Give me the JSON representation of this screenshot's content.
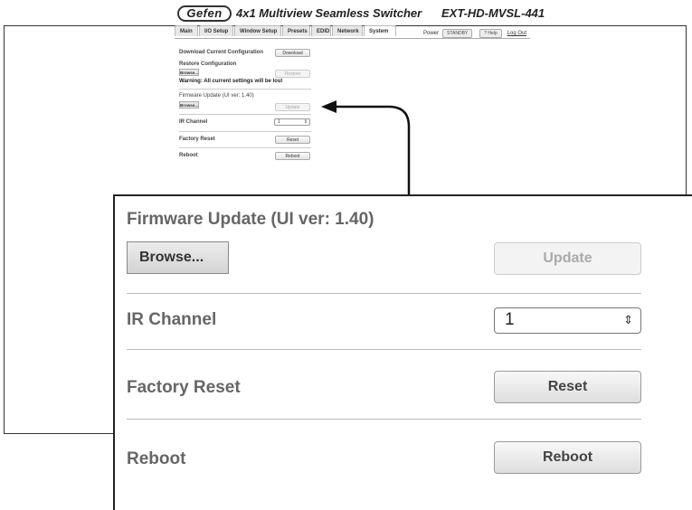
{
  "header": {
    "logo": "Gefen",
    "title": "4x1 Multiview Seamless Switcher",
    "model": "EXT-HD-MVSL-441"
  },
  "tabs": [
    {
      "label": "Main"
    },
    {
      "label": "I/O Setup"
    },
    {
      "label": "Window Setup"
    },
    {
      "label": "Presets"
    },
    {
      "label": "EDID"
    },
    {
      "label": "Network"
    },
    {
      "label": "System",
      "active": true
    }
  ],
  "topbar": {
    "power_label": "Power",
    "standby_label": "STANDBY",
    "help_label": "? Help",
    "logout_label": "Log Out"
  },
  "system": {
    "download_label": "Download Current Configuration",
    "download_button": "Download",
    "restore_label": "Restore Configuration",
    "browse_button": "Browse...",
    "restore_button": "Restore",
    "warning": "Warning: All current settings will be lost",
    "firmware_label": "Firmware Update (UI ver: 1.40)",
    "update_button": "Update",
    "ir_label": "IR Channel",
    "ir_value": "1",
    "factory_label": "Factory Reset",
    "reset_button": "Reset",
    "reboot_label": "Reboot",
    "reboot_button": "Reboot"
  },
  "zoom": {
    "firmware_label": "Firmware Update (UI ver: 1.40)",
    "browse_button": "Browse...",
    "update_button": "Update",
    "ir_label": "IR Channel",
    "ir_value": "1",
    "factory_label": "Factory Reset",
    "reset_button": "Reset",
    "reboot_label": "Reboot",
    "reboot_button": "Reboot"
  },
  "icons": {
    "select_arrows": "up-down-chevron-icon",
    "callout_arrow": "arrow-left-icon"
  }
}
